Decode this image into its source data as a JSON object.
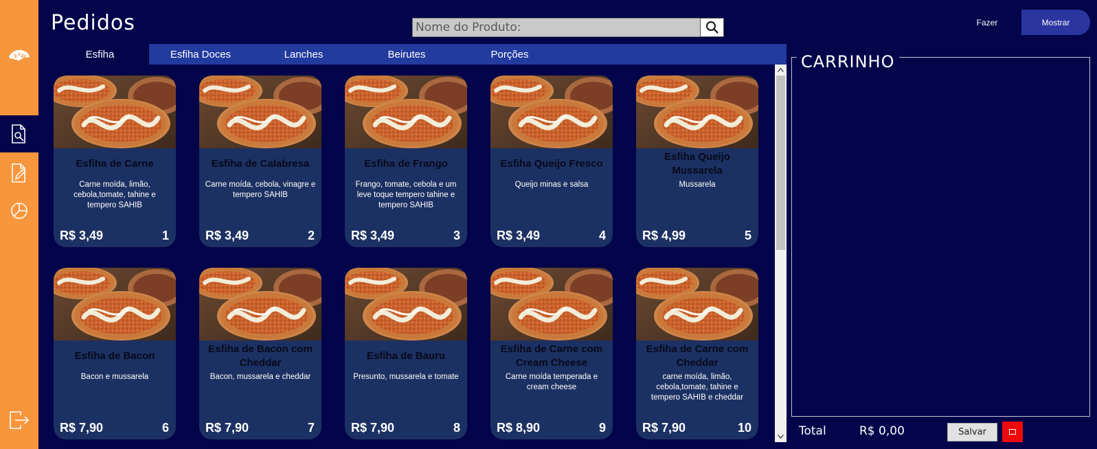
{
  "header": {
    "title": "Pedidos",
    "search_placeholder": "Nome do Produto:",
    "fazer_label": "Fazer",
    "mostrar_label": "Mostrar"
  },
  "sidebar": {
    "items": [
      {
        "name": "logo",
        "icon": "tiger-logo-icon"
      },
      {
        "name": "orders",
        "icon": "document-search-icon",
        "active": true
      },
      {
        "name": "edit",
        "icon": "document-edit-icon"
      },
      {
        "name": "reports",
        "icon": "pie-chart-icon"
      },
      {
        "name": "exit",
        "icon": "logout-icon"
      }
    ]
  },
  "tabs": [
    "Esfiha",
    "Esfiha Doces",
    "Lanches",
    "Beirutes",
    "Porções"
  ],
  "active_tab": "Esfiha",
  "products": [
    {
      "name": "Esfiha de Carne",
      "desc": "Carne moída, limão, cebola,tomate, tahine e tempero SAHIB",
      "price": "R$ 3,49",
      "num": "1"
    },
    {
      "name": "Esfiha de Calabresa",
      "desc": "Carne moída, cebola, vinagre e tempero SAHIB",
      "price": "R$ 3,49",
      "num": "2"
    },
    {
      "name": "Esfiha de Frango",
      "desc": "Frango, tomate, cebola e um leve toque tempero tahine e tempero SAHIB",
      "price": "R$ 3,49",
      "num": "3"
    },
    {
      "name": "Esfiha Queijo Fresco",
      "desc": "Queijo minas e salsa",
      "price": "R$ 3,49",
      "num": "4"
    },
    {
      "name": "Esfiha Queijo Mussarela",
      "desc": "Mussarela",
      "price": "R$ 4,99",
      "num": "5"
    },
    {
      "name": "Esfiha de Bacon",
      "desc": "Bacon e mussarela",
      "price": "R$ 7,90",
      "num": "6"
    },
    {
      "name": "Esfiha de Bacon com Cheddar",
      "desc": "Bacon, mussarela e cheddar",
      "price": "R$ 7,90",
      "num": "7"
    },
    {
      "name": "Esfiha de Bauru",
      "desc": "Presunto, mussarela e tomate",
      "price": "R$ 7,90",
      "num": "8"
    },
    {
      "name": "Esfiha de Carne com Cream Cheese",
      "desc": "Carne moída temperada e cream cheese",
      "price": "R$ 8,90",
      "num": "9"
    },
    {
      "name": "Esfiha de Carne com Cheddar",
      "desc": "carne moída, limão, cebola,tomate, tahine e tempero SAHIB e cheddar",
      "price": "R$ 7,90",
      "num": "10"
    }
  ],
  "cart": {
    "title": "CARRINHO",
    "total_label": "Total",
    "total_value": "R$ 0,00",
    "save_label": "Salvar"
  },
  "colors": {
    "background": "#03044a",
    "sidebar": "#f7963c",
    "tabbar": "#233a9e",
    "card": "#1c3163",
    "accent_button": "#2a35a0",
    "delete": "#ee0a0a"
  }
}
